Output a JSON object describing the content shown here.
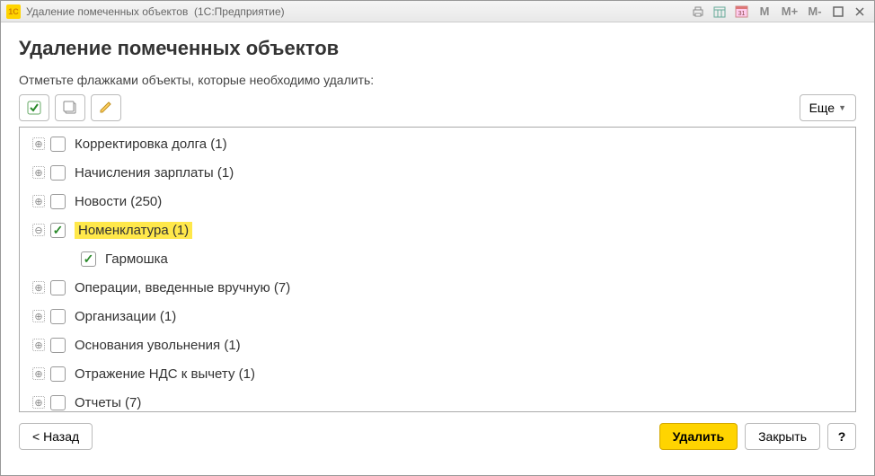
{
  "window": {
    "title": "Удаление помеченных объектов",
    "subtitle": "(1С:Предприятие)"
  },
  "page": {
    "heading": "Удаление помеченных объектов",
    "instruction": "Отметьте флажками объекты, которые необходимо удалить:"
  },
  "toolbar": {
    "more_label": "Еще"
  },
  "tree": [
    {
      "label": "Корректировка долга (1)",
      "checked": false,
      "expanded": false,
      "expandable": true,
      "highlighted": false,
      "level": 0
    },
    {
      "label": "Начисления зарплаты (1)",
      "checked": false,
      "expanded": false,
      "expandable": true,
      "highlighted": false,
      "level": 0
    },
    {
      "label": "Новости (250)",
      "checked": false,
      "expanded": false,
      "expandable": true,
      "highlighted": false,
      "level": 0
    },
    {
      "label": "Номенклатура (1)",
      "checked": true,
      "expanded": true,
      "expandable": true,
      "highlighted": true,
      "level": 0
    },
    {
      "label": "Гармошка",
      "checked": true,
      "expanded": false,
      "expandable": false,
      "highlighted": false,
      "level": 1
    },
    {
      "label": "Операции, введенные вручную (7)",
      "checked": false,
      "expanded": false,
      "expandable": true,
      "highlighted": false,
      "level": 0
    },
    {
      "label": "Организации (1)",
      "checked": false,
      "expanded": false,
      "expandable": true,
      "highlighted": false,
      "level": 0
    },
    {
      "label": "Основания увольнения (1)",
      "checked": false,
      "expanded": false,
      "expandable": true,
      "highlighted": false,
      "level": 0
    },
    {
      "label": "Отражение НДС к вычету (1)",
      "checked": false,
      "expanded": false,
      "expandable": true,
      "highlighted": false,
      "level": 0
    },
    {
      "label": "Отчеты (7)",
      "checked": false,
      "expanded": false,
      "expandable": true,
      "highlighted": false,
      "level": 0
    }
  ],
  "footer": {
    "back": "< Назад",
    "delete": "Удалить",
    "close": "Закрыть",
    "help": "?"
  }
}
